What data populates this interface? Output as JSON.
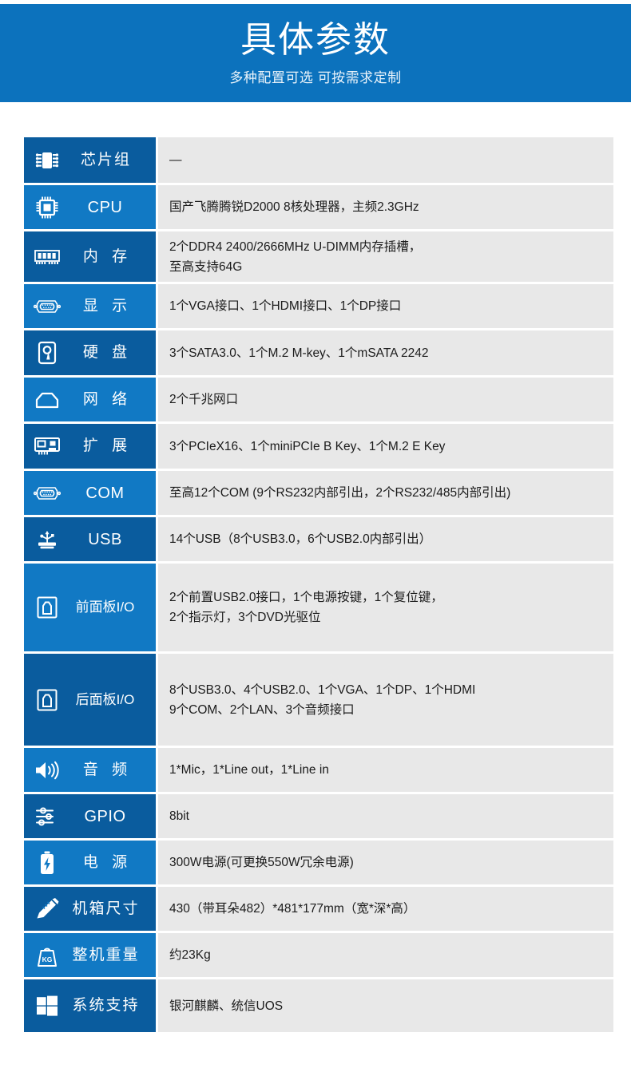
{
  "banner": {
    "title": "具体参数",
    "subtitle": "多种配置可选 可按需求定制",
    "background": "#0c72bd"
  },
  "colors": {
    "label_dark": "#0a5c9e",
    "label_light": "#1179c4",
    "value_bg": "#e8e8e8",
    "value_text": "#1b1b1b"
  },
  "spec_rows": [
    {
      "icon": "chipset-icon",
      "label": "芯片组",
      "value": "—"
    },
    {
      "icon": "cpu-icon",
      "label": "CPU",
      "value": "国产飞腾腾锐D2000 8核处理器，主频2.3GHz"
    },
    {
      "icon": "memory-icon",
      "label": "内 存",
      "value": "2个DDR4 2400/2666MHz U-DIMM内存插槽，\n至高支持64G"
    },
    {
      "icon": "vga-display-icon",
      "label": "显 示",
      "value": "1个VGA接口、1个HDMI接口、1个DP接口"
    },
    {
      "icon": "harddisk-icon",
      "label": "硬 盘",
      "value": "3个SATA3.0、1个M.2 M-key、1个mSATA 2242"
    },
    {
      "icon": "network-rj45-icon",
      "label": "网 络",
      "value": "2个千兆网口"
    },
    {
      "icon": "expansion-card-icon",
      "label": "扩 展",
      "value": "3个PCIeX16、1个miniPCIe B Key、1个M.2 E Key"
    },
    {
      "icon": "serial-db9-icon",
      "label": "COM",
      "value": "至高12个COM (9个RS232内部引出，2个RS232/485内部引出)"
    },
    {
      "icon": "usb-icon",
      "label": "USB",
      "value": "14个USB（8个USB3.0，6个USB2.0内部引出）"
    },
    {
      "icon": "front-panel-io-icon",
      "label": "前面板I/O",
      "value": "2个前置USB2.0接口，1个电源按键，1个复位键，\n2个指示灯，3个DVD光驱位"
    },
    {
      "icon": "rear-panel-io-icon",
      "label": "后面板I/O",
      "value": "8个USB3.0、4个USB2.0、1个VGA、1个DP、1个HDMI\n9个COM、2个LAN、3个音频接口"
    },
    {
      "icon": "speaker-icon",
      "label": "音 频",
      "value": "1*Mic，1*Line out，1*Line in"
    },
    {
      "icon": "sliders-icon",
      "label": "GPIO",
      "value": "8bit"
    },
    {
      "icon": "battery-bolt-icon",
      "label": "电 源",
      "value": "300W电源(可更换550W冗余电源)"
    },
    {
      "icon": "ruler-pencil-icon",
      "label": "机箱尺寸",
      "value": "430（带耳朵482）*481*177mm（宽*深*高）"
    },
    {
      "icon": "weight-kg-icon",
      "label": "整机重量",
      "value": "约23Kg"
    },
    {
      "icon": "windows-icon",
      "label": "系统支持",
      "value": "银河麒麟、统信UOS"
    }
  ]
}
